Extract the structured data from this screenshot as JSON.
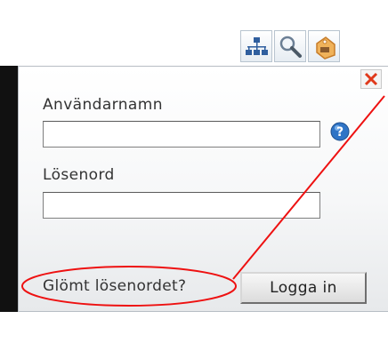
{
  "toolbar": {
    "icons": [
      "sitemap-icon",
      "search-icon",
      "shopping-tag-icon"
    ]
  },
  "login": {
    "username_label": "Användarnamn",
    "username_value": "",
    "password_label": "Lösenord",
    "password_value": "",
    "forgot_link": "Glömt lösenordet?",
    "login_button": "Logga in"
  },
  "colors": {
    "annotation": "#ee1111",
    "close_icon": "#e0391b",
    "help_icon": "#2f74c6"
  }
}
